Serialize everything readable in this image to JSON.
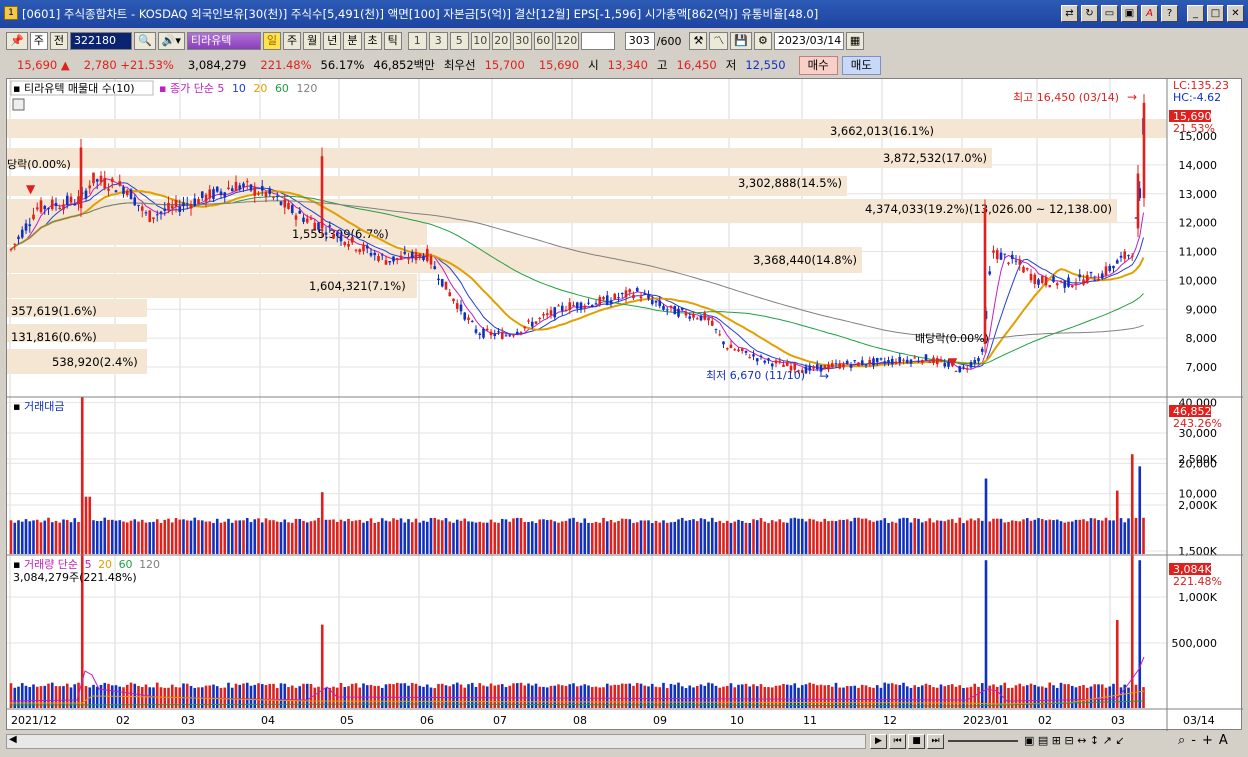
{
  "window": {
    "title": "[0601] 주식종합차트 - KOSDAQ 외국인보유[30(천)] 주식수[5,491(천)] 액면[100] 자본금[5(억)] 결산[12월] EPS[-1,596] 시가총액[862(억)] 유통비율[48.0]",
    "app_icon": "1",
    "buttons": [
      "link-icon",
      "refresh-icon",
      "window-icon",
      "image-icon",
      "font-icon",
      "help-icon",
      "minimize-icon",
      "maximize-icon",
      "close-icon"
    ]
  },
  "toolbar": {
    "type_select": "주",
    "prev_label": "전",
    "code": "322180",
    "stock_name": "티라유텍",
    "day_btn": "일",
    "week_btn": "주",
    "month_btn": "월",
    "year_btn": "년",
    "minute_btn": "분",
    "second_btn": "초",
    "tick_btn": "틱",
    "periods": [
      "1",
      "3",
      "5",
      "10",
      "20",
      "30",
      "60",
      "120"
    ],
    "count": "303",
    "count_total": "/600",
    "date": "2023/03/14"
  },
  "quote": {
    "price": "15,690",
    "change": "2,780",
    "change_pct": "+21.53%",
    "volume": "3,084,279",
    "volume_pct": "221.48%",
    "turnover_pct": "56.17%",
    "amount": "46,852백만",
    "best_label": "최우선",
    "ask": "15,700",
    "bid": "15,690",
    "open_label": "시",
    "open": "13,340",
    "high_label": "고",
    "high": "16,450",
    "low_label": "저",
    "low": "12,550",
    "buy_label": "매수",
    "sell_label": "매도"
  },
  "colors": {
    "up": "#e0201c",
    "down": "#1030c0",
    "ma5": "#c020c0",
    "ma10": "#2040d0",
    "ma20": "#e0a000",
    "ma60": "#20a040",
    "ma120": "#808080",
    "profile": "#f5e6d3"
  },
  "price_panel": {
    "legend_title": "티라유텍 매물대 수(10)",
    "legend_ma_title": "종가 단순 5",
    "ma_periods": [
      "10",
      "20",
      "60",
      "120"
    ],
    "lc": "LC:135.23",
    "hc": "HC:-4.62",
    "last_price": "15,690",
    "last_pct": "21.53%",
    "y_ticks": [
      "15,000",
      "14,000",
      "13,000",
      "12,000",
      "11,000",
      "10,000",
      "9,000",
      "8,000",
      "7,000"
    ],
    "profile_labels": [
      "3,662,013(16.1%)",
      "3,872,532(17.0%)",
      "3,302,888(14.5%)",
      "4,374,033(19.2%)(13,026.00 ~ 12,138.00)",
      "1,555,309(6.7%)",
      "3,368,440(14.8%)",
      "1,604,321(7.1%)",
      "357,619(1.6%)",
      "131,816(0.6%)",
      "538,920(2.4%)"
    ],
    "high_note": "최고 16,450 (03/14)",
    "low_note": "최저 6,670 (11/10)",
    "dividend_left": "당락(0.00%)",
    "dividend_right": "배당락(0.00%)"
  },
  "amount_panel": {
    "title": "거래대금",
    "last": "46,852",
    "last_pct": "243.26%",
    "y_ticks": [
      "40,000",
      "30,000",
      "20,000",
      "10,000"
    ]
  },
  "volume_panel": {
    "title": "거래량 단순",
    "ma_periods": [
      "5",
      "20",
      "60",
      "120"
    ],
    "current": "3,084,279주(221.48%)",
    "last": "3,084K",
    "last_pct": "221.48%",
    "y_ticks": [
      "2,500K",
      "2,000K",
      "1,500K",
      "1,000K",
      "500,000"
    ]
  },
  "x_axis": {
    "labels": [
      "2021/12",
      "02",
      "03",
      "04",
      "05",
      "06",
      "07",
      "08",
      "09",
      "10",
      "11",
      "12",
      "2023/01",
      "02",
      "03"
    ],
    "end_label": "03/14"
  },
  "bottom": {
    "nav": [
      "◀",
      "▶",
      "⏮",
      "■",
      "⏭"
    ],
    "zoom": [
      "-",
      "+",
      "A"
    ]
  }
}
